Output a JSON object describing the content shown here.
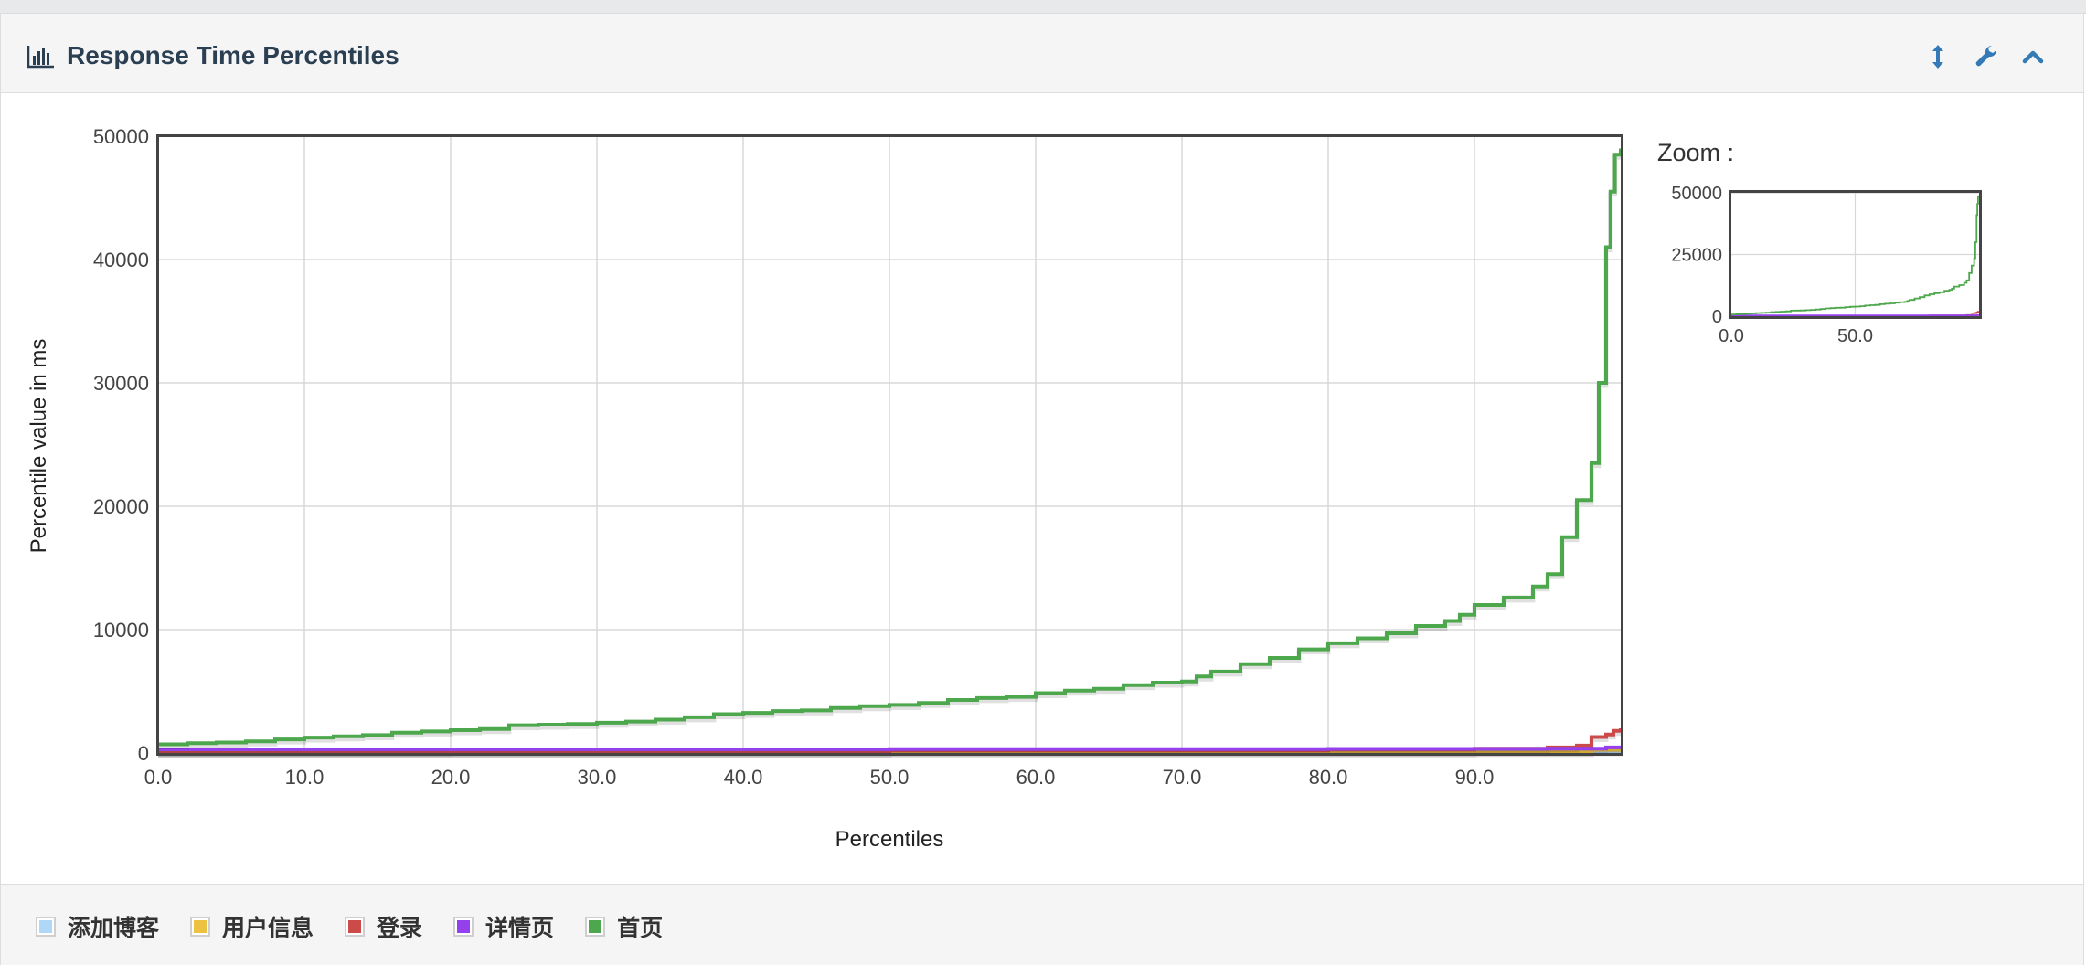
{
  "panel": {
    "title": "Response Time Percentiles",
    "icons": [
      "bar-chart-icon",
      "resize-vertical-icon",
      "wrench-icon",
      "chevron-up-icon"
    ]
  },
  "zoom": {
    "label": "Zoom :"
  },
  "chart_data": {
    "type": "line",
    "title": "",
    "xlabel": "Percentiles",
    "ylabel": "Percentile value in ms",
    "xlim": [
      0,
      100
    ],
    "ylim": [
      0,
      50000
    ],
    "x_ticks": [
      "0.0",
      "10.0",
      "20.0",
      "30.0",
      "40.0",
      "50.0",
      "60.0",
      "70.0",
      "80.0",
      "90.0"
    ],
    "y_ticks": [
      "0",
      "10000",
      "20000",
      "30000",
      "40000",
      "50000"
    ],
    "grid": true,
    "legend_position": "bottom",
    "series": [
      {
        "name": "添加博客",
        "color": "#afd8f8",
        "x": [
          0,
          50,
          90,
          98,
          100
        ],
        "y": [
          40,
          60,
          80,
          150,
          250
        ]
      },
      {
        "name": "用户信息",
        "color": "#edc240",
        "x": [
          0,
          50,
          90,
          98,
          100
        ],
        "y": [
          60,
          90,
          150,
          250,
          400
        ]
      },
      {
        "name": "登录",
        "color": "#cb4b4b",
        "x": [
          0,
          20,
          50,
          80,
          90,
          95,
          97,
          98,
          99,
          99.5,
          100
        ],
        "y": [
          100,
          150,
          200,
          280,
          350,
          450,
          600,
          1300,
          1500,
          1800,
          2000
        ]
      },
      {
        "name": "详情页",
        "color": "#9440ed",
        "x": [
          0,
          20,
          50,
          80,
          95,
          99,
          100
        ],
        "y": [
          300,
          300,
          320,
          330,
          350,
          450,
          600
        ]
      },
      {
        "name": "首页",
        "color": "#4da74d",
        "x": [
          0,
          2,
          4,
          6,
          8,
          10,
          12,
          14,
          16,
          18,
          20,
          22,
          24,
          26,
          28,
          30,
          32,
          34,
          36,
          38,
          40,
          42,
          44,
          46,
          48,
          50,
          52,
          54,
          56,
          58,
          60,
          62,
          64,
          66,
          68,
          70,
          71,
          72,
          74,
          76,
          78,
          80,
          82,
          84,
          86,
          88,
          89,
          90,
          92,
          94,
          95,
          96,
          97,
          98,
          98.5,
          99,
          99.3,
          99.6,
          100
        ],
        "y": [
          700,
          800,
          850,
          950,
          1100,
          1250,
          1350,
          1450,
          1650,
          1750,
          1850,
          1950,
          2250,
          2300,
          2350,
          2450,
          2550,
          2700,
          2900,
          3150,
          3250,
          3400,
          3450,
          3650,
          3800,
          3900,
          4050,
          4300,
          4450,
          4550,
          4850,
          5050,
          5200,
          5500,
          5700,
          5800,
          6200,
          6600,
          7200,
          7700,
          8400,
          8900,
          9300,
          9700,
          10300,
          10700,
          11200,
          12000,
          12600,
          13500,
          14500,
          17500,
          20500,
          23500,
          30000,
          41000,
          45500,
          48500,
          49000
        ]
      }
    ]
  },
  "zoom_chart": {
    "y_ticks": [
      "0",
      "25000",
      "50000"
    ],
    "x_ticks": [
      "0.0",
      "50.0"
    ]
  }
}
